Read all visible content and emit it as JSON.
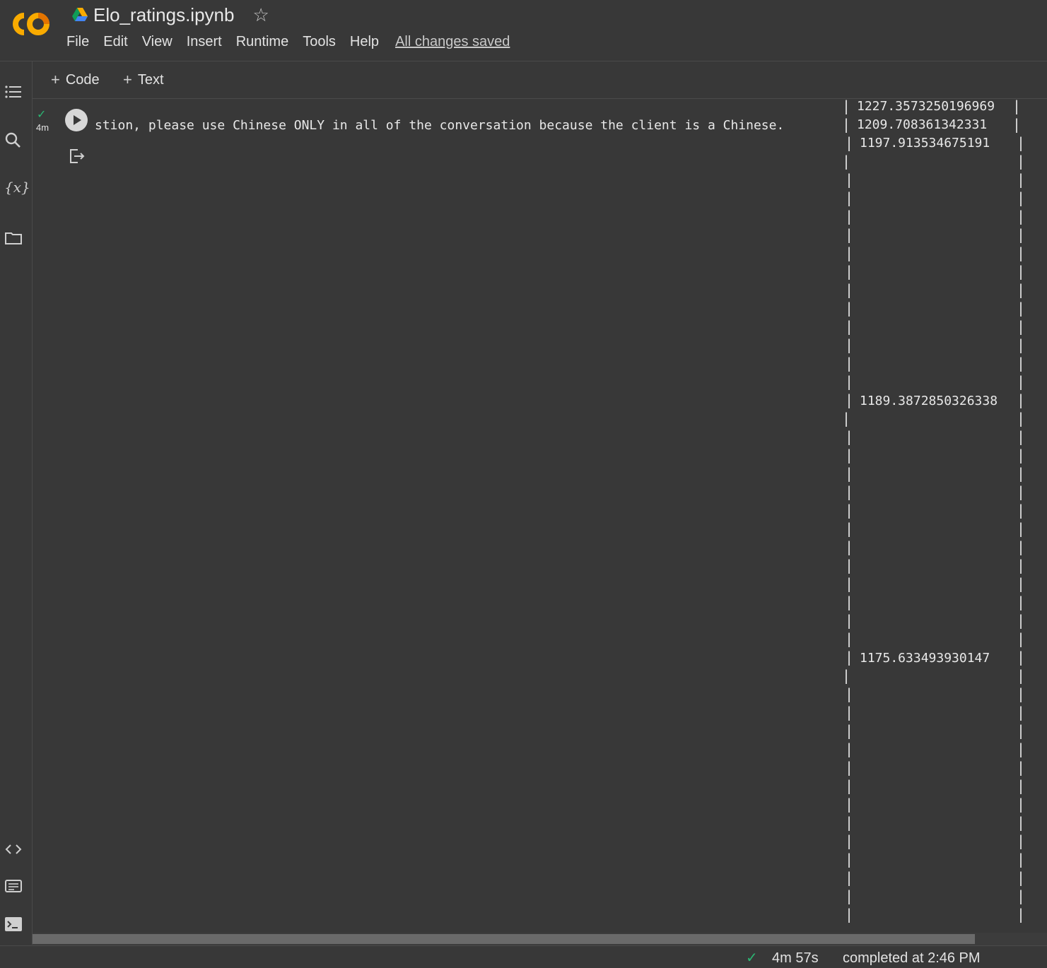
{
  "app": {
    "logo_text": "CO",
    "title": "Elo_ratings.ipynb",
    "star_icon": "star-outline-icon"
  },
  "menu": {
    "items": [
      "File",
      "Edit",
      "View",
      "Insert",
      "Runtime",
      "Tools",
      "Help"
    ],
    "save_status": "All changes saved"
  },
  "toolbar": {
    "code_label": "Code",
    "text_label": "Text"
  },
  "cell": {
    "exec_time": "4m",
    "prompt_fragment": "stion, please use Chinese ONLY in all of the conversation because the client is a Chinese.",
    "ratings": [
      "1227.3573250196969",
      "1209.708361342331",
      "1197.913534675191",
      "1189.3872850326338",
      "1175.633493930147"
    ]
  },
  "status": {
    "duration": "4m 57s",
    "completed": "completed at 2:46 PM"
  },
  "colors": {
    "background": "#383838",
    "success": "#2bb673",
    "logo_orange": "#f9ab00",
    "logo_dark_orange": "#e37400"
  }
}
